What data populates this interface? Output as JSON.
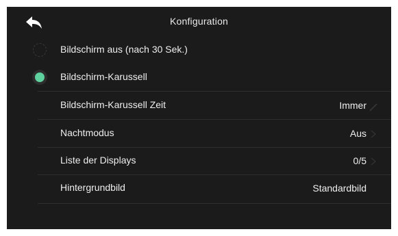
{
  "header": {
    "title": "Konfiguration",
    "back_icon": "back-arrow-icon"
  },
  "options": [
    {
      "label": "Bildschirm aus (nach 30 Sek.)",
      "selected": false
    },
    {
      "label": "Bildschirm-Karussell",
      "selected": true
    }
  ],
  "settings": [
    {
      "label": "Bildschirm-Karussell Zeit",
      "value": "Immer"
    },
    {
      "label": "Nachtmodus",
      "value": "Aus"
    },
    {
      "label": "Liste der Displays",
      "value": "0/5"
    },
    {
      "label": "Hintergrundbild",
      "value": "Standardbild"
    }
  ],
  "colors": {
    "background": "#1b1b1b",
    "accent": "#5fd19f",
    "text": "#efefef"
  }
}
